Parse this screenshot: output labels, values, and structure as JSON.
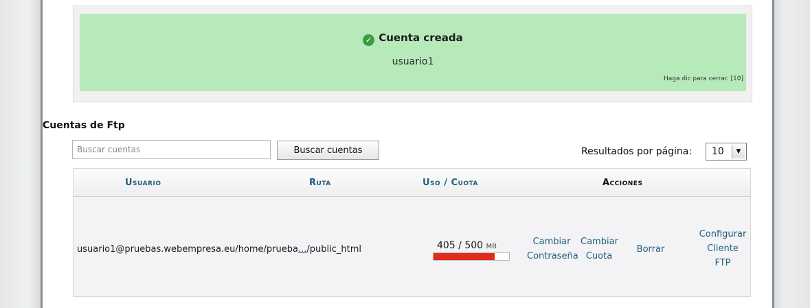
{
  "colors": {
    "notice_bg": "#b7eabb",
    "link": "#1e5f7a",
    "usage_bar": "#e22b1a"
  },
  "notice": {
    "icon": "check-circle-icon",
    "title": "Cuenta creada",
    "username": "usuario1",
    "close_text": "Haga dic para cerrar. [10]"
  },
  "section": {
    "title": "Cuentas de Ftp"
  },
  "search": {
    "placeholder": "Buscar cuentas",
    "button_label": "Buscar cuentas"
  },
  "pagination": {
    "label": "Resultados por página:",
    "per_page": "10"
  },
  "table": {
    "headers": {
      "usuario": "Usuario",
      "ruta": "Ruta",
      "uso": "Uso / Cuota",
      "acciones": "Acciones"
    },
    "rows": [
      {
        "account_path_prefix": "usuario1@pruebas.webempresa.eu/home/prueba",
        "path_ellipsis": "...",
        "path_suffix": "/public_html",
        "usage": "405 / 500",
        "usage_unit": "MB",
        "usage_fraction": 0.81,
        "actions": {
          "change_password": [
            "Cambiar",
            "Contraseña"
          ],
          "change_quota": [
            "Cambiar",
            "Cuota"
          ],
          "delete": "Borrar",
          "configure_client": [
            "Configurar",
            "Cliente",
            "FTP"
          ]
        }
      }
    ]
  }
}
